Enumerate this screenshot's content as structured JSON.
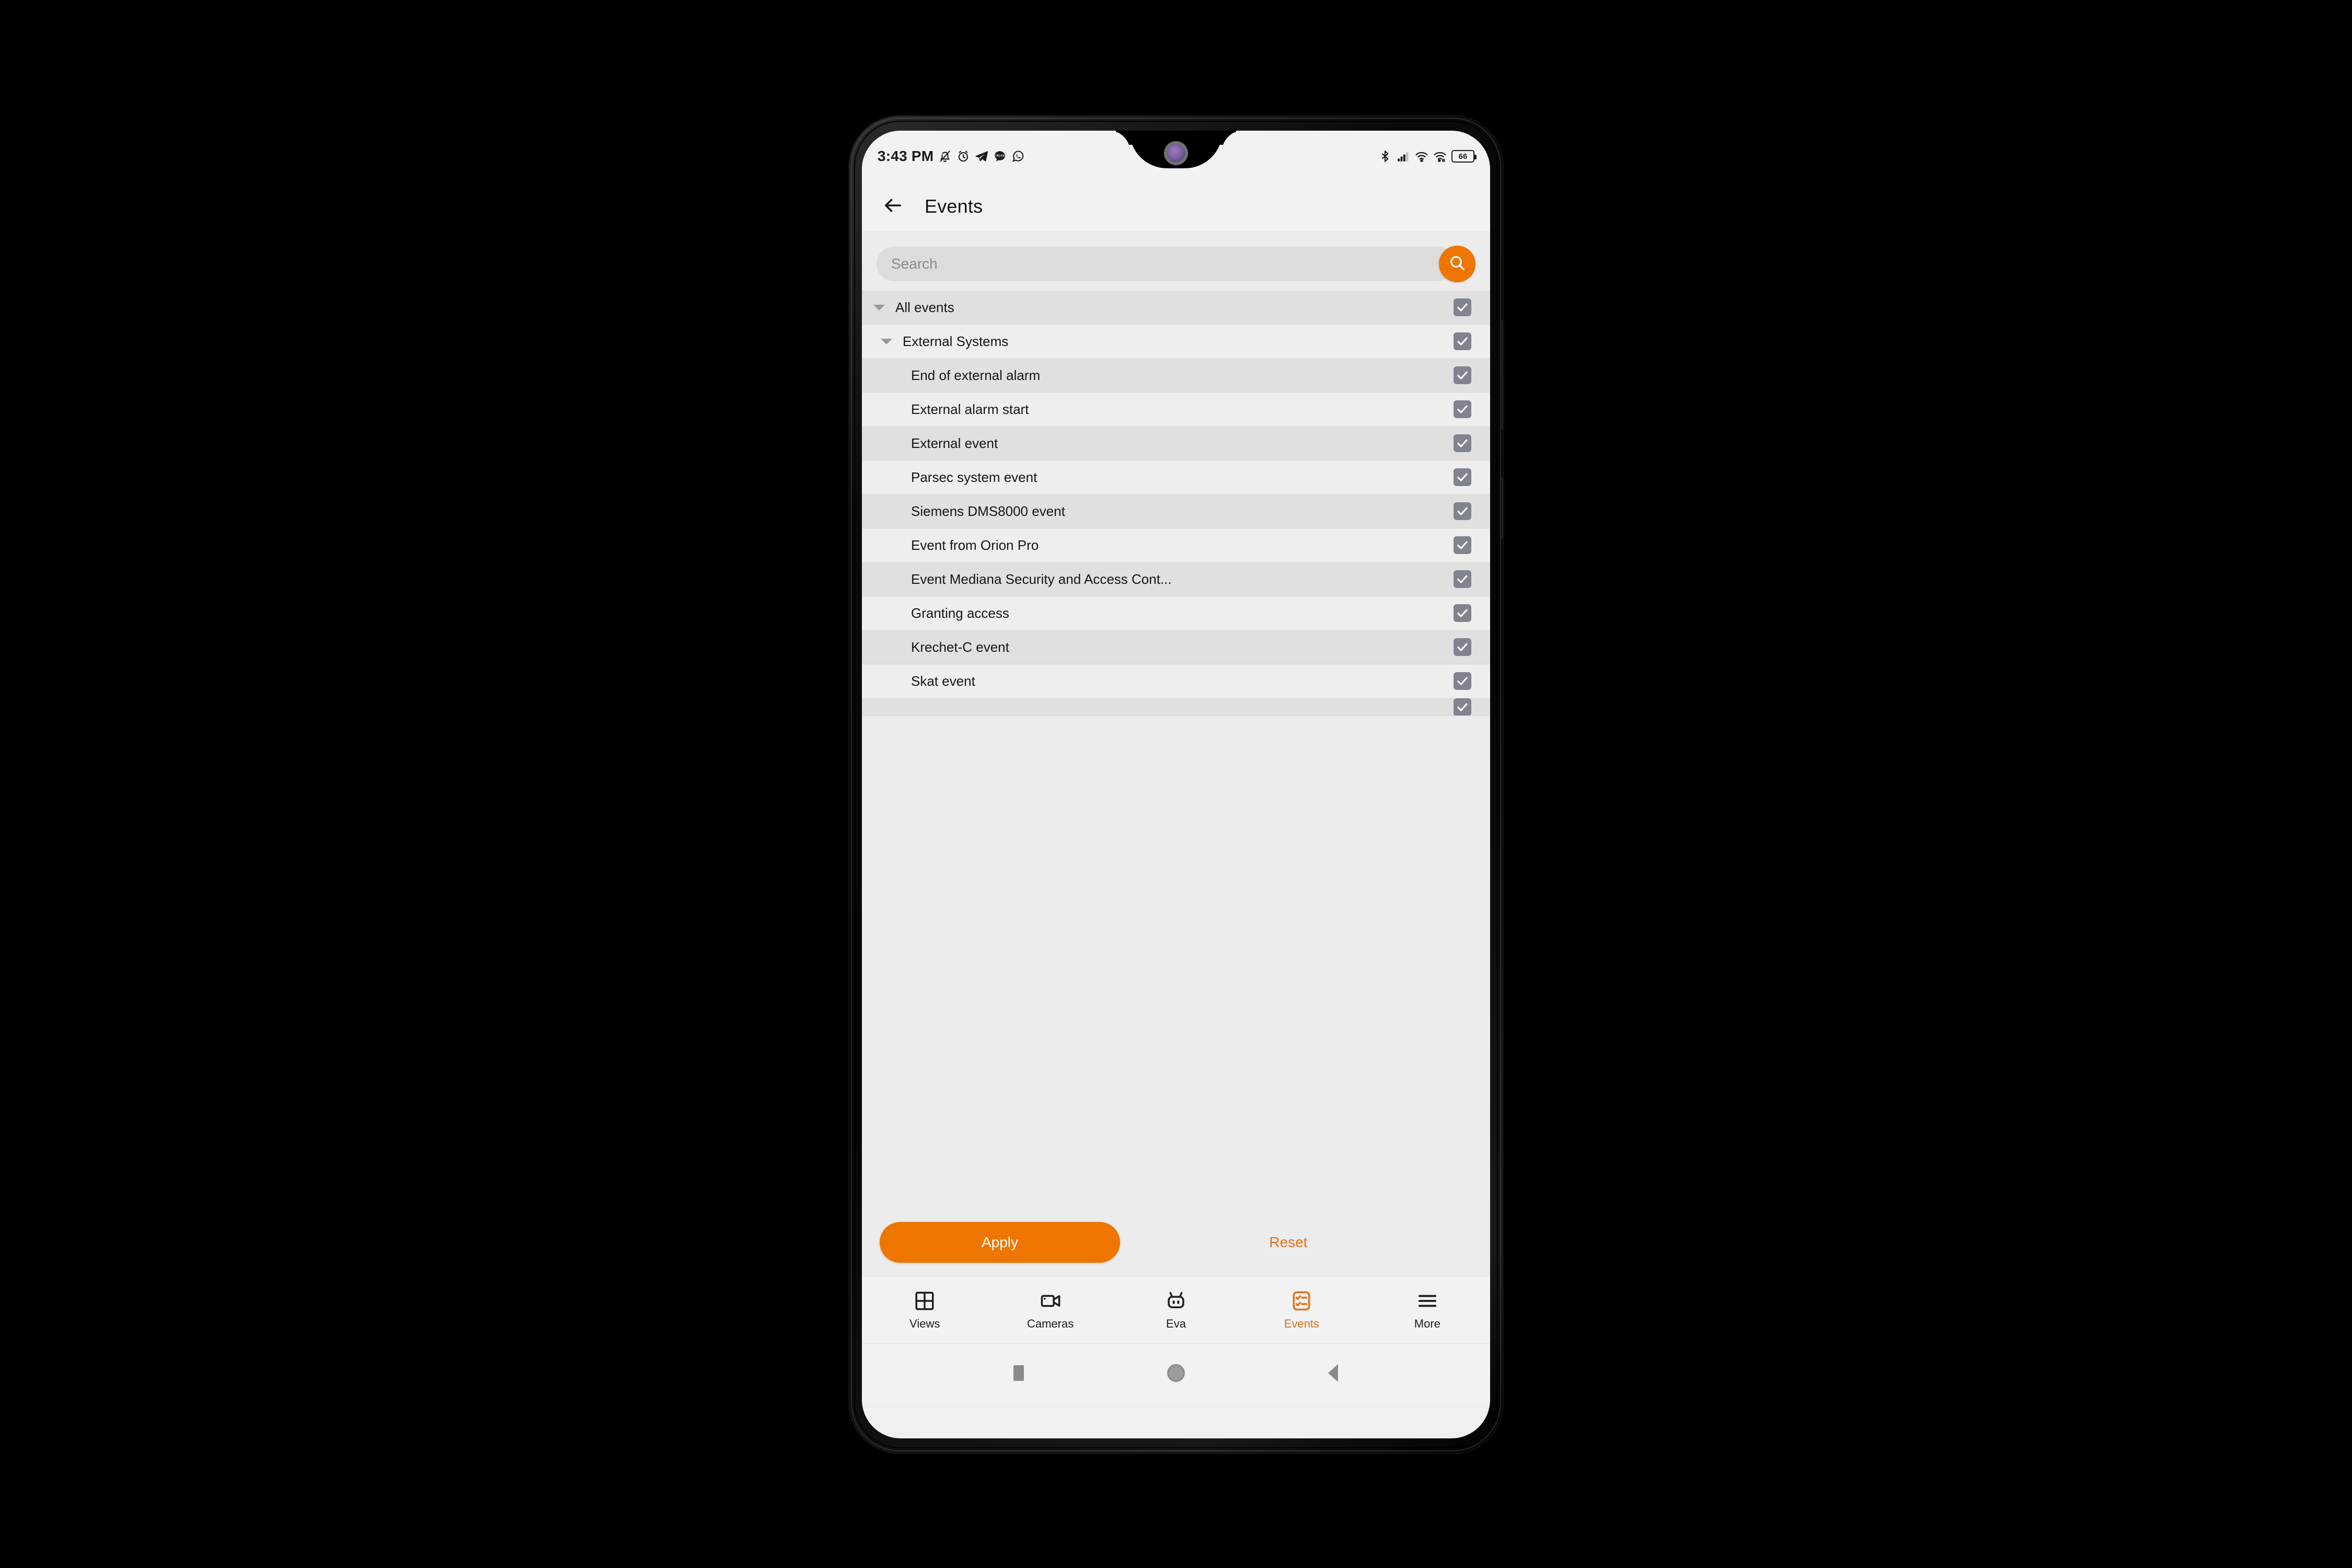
{
  "status_bar": {
    "time": "3:43 PM",
    "battery_level": "66",
    "left_icons": [
      "mute-bell-icon",
      "alarm-clock-icon",
      "telegram-icon",
      "talks-icon",
      "whatsapp-icon"
    ],
    "right_icons": [
      "bluetooth-icon",
      "signal-bars-icon",
      "wifi-icon",
      "wifi-secondary-icon",
      "battery-icon"
    ]
  },
  "app_bar": {
    "back_icon": "back-arrow-icon",
    "title": "Events"
  },
  "search": {
    "placeholder": "Search",
    "value": "",
    "button_icon": "search-icon"
  },
  "event_list": [
    {
      "label": "All events",
      "level": 0,
      "expandable": true,
      "checked": true,
      "shade": "alt"
    },
    {
      "label": "External Systems",
      "level": 1,
      "expandable": true,
      "checked": true,
      "shade": "norm"
    },
    {
      "label": "End of external alarm",
      "level": 2,
      "expandable": false,
      "checked": true,
      "shade": "alt"
    },
    {
      "label": "External alarm start",
      "level": 2,
      "expandable": false,
      "checked": true,
      "shade": "norm"
    },
    {
      "label": "External event",
      "level": 2,
      "expandable": false,
      "checked": true,
      "shade": "alt"
    },
    {
      "label": "Parsec system event",
      "level": 2,
      "expandable": false,
      "checked": true,
      "shade": "norm"
    },
    {
      "label": "Siemens DMS8000 event",
      "level": 2,
      "expandable": false,
      "checked": true,
      "shade": "alt"
    },
    {
      "label": "Event from Orion Pro",
      "level": 2,
      "expandable": false,
      "checked": true,
      "shade": "norm"
    },
    {
      "label": "Event Mediana Security and Access Cont...",
      "level": 2,
      "expandable": false,
      "checked": true,
      "shade": "alt"
    },
    {
      "label": "Granting access",
      "level": 2,
      "expandable": false,
      "checked": true,
      "shade": "norm"
    },
    {
      "label": "Krechet-C event",
      "level": 2,
      "expandable": false,
      "checked": true,
      "shade": "alt"
    },
    {
      "label": "Skat event",
      "level": 2,
      "expandable": false,
      "checked": true,
      "shade": "norm"
    },
    {
      "label": "",
      "level": 2,
      "expandable": false,
      "checked": true,
      "shade": "alt",
      "clipped": true
    }
  ],
  "actions": {
    "apply_label": "Apply",
    "reset_label": "Reset"
  },
  "bottom_nav": {
    "active": "Events",
    "items": [
      {
        "label": "Views",
        "icon": "grid-icon"
      },
      {
        "label": "Cameras",
        "icon": "video-camera-icon"
      },
      {
        "label": "Eva",
        "icon": "robot-icon"
      },
      {
        "label": "Events",
        "icon": "checklist-icon"
      },
      {
        "label": "More",
        "icon": "hamburger-menu-icon"
      }
    ]
  },
  "android_nav": {
    "recents_icon": "recents-square-icon",
    "home_icon": "home-circle-icon",
    "back_icon": "back-triangle-icon"
  },
  "colors": {
    "accent_orange": "#ee7600",
    "reset_orange": "#e27214",
    "checkbox_slate": "#81848f",
    "panel_bg": "#ececec",
    "row_alt": "#e0e0e0",
    "row_norm": "#eeeeee"
  }
}
